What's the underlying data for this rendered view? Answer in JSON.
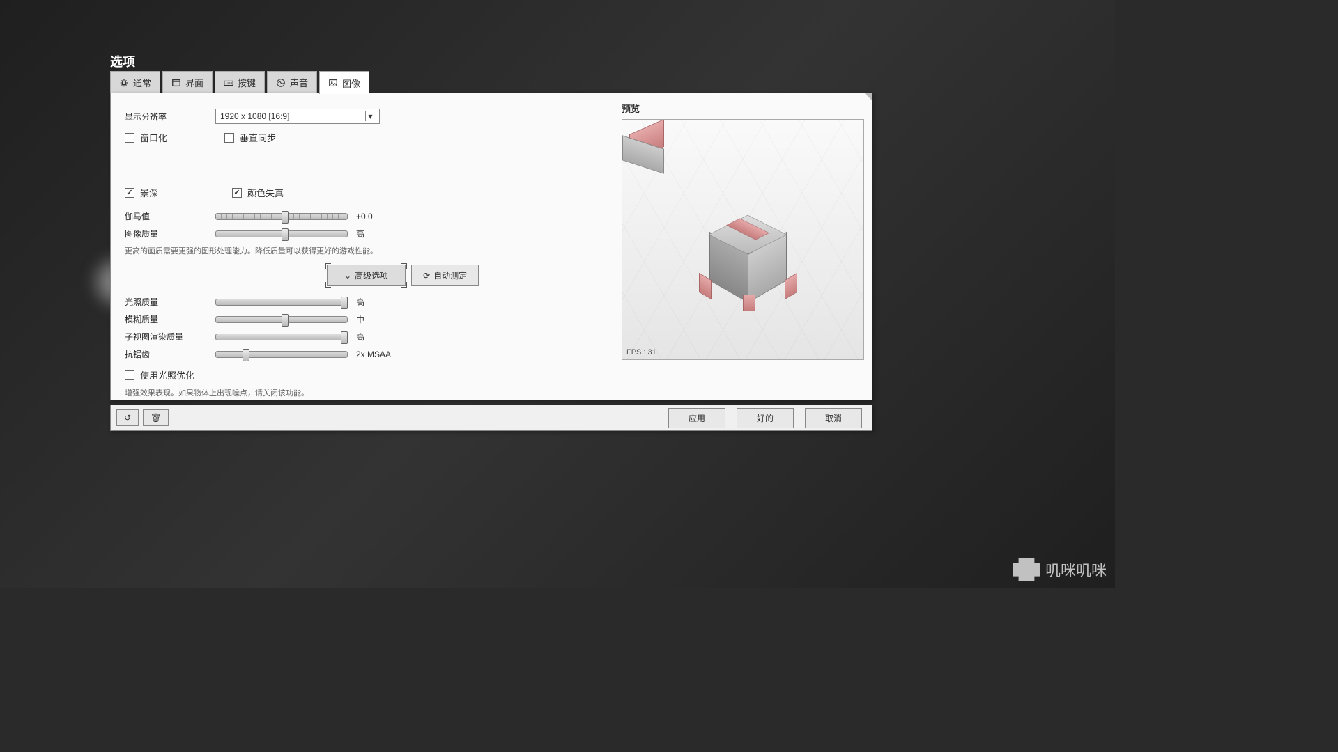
{
  "title": "选项",
  "tabs": [
    {
      "label": "通常",
      "icon": "gear"
    },
    {
      "label": "界面",
      "icon": "ui"
    },
    {
      "label": "按键",
      "icon": "keyboard"
    },
    {
      "label": "声音",
      "icon": "audio"
    },
    {
      "label": "图像",
      "icon": "image"
    }
  ],
  "activeTab": 4,
  "settings": {
    "resolution_label": "显示分辨率",
    "resolution_value": "1920 x 1080       [16:9]",
    "windowed_label": "窗口化",
    "vsync_label": "垂直同步",
    "dof_label": "景深",
    "chromatic_label": "颜色失真",
    "gamma_label": "伽马值",
    "gamma_value": "+0.0",
    "quality_label": "图像质量",
    "quality_value": "高",
    "quality_hint": "更高的画质需要更强的图形处理能力。降低质量可以获得更好的游戏性能。",
    "advanced_btn": "高级选项",
    "autodetect_btn": "自动测定",
    "lighting_label": "光照质量",
    "lighting_value": "高",
    "blur_label": "模糊质量",
    "blur_value": "中",
    "subview_label": "子视图渲染质量",
    "subview_value": "高",
    "antialias_label": "抗锯齿",
    "antialias_value": "2x MSAA",
    "lightopt_label": "使用光照优化",
    "lightopt_hint": "增强效果表现。如果物体上出现噪点，请关闭该功能。"
  },
  "preview": {
    "title": "预览",
    "fps": "FPS : 31"
  },
  "footer": {
    "apply": "应用",
    "ok": "好的",
    "cancel": "取消"
  },
  "watermark": "叽咪叽咪"
}
